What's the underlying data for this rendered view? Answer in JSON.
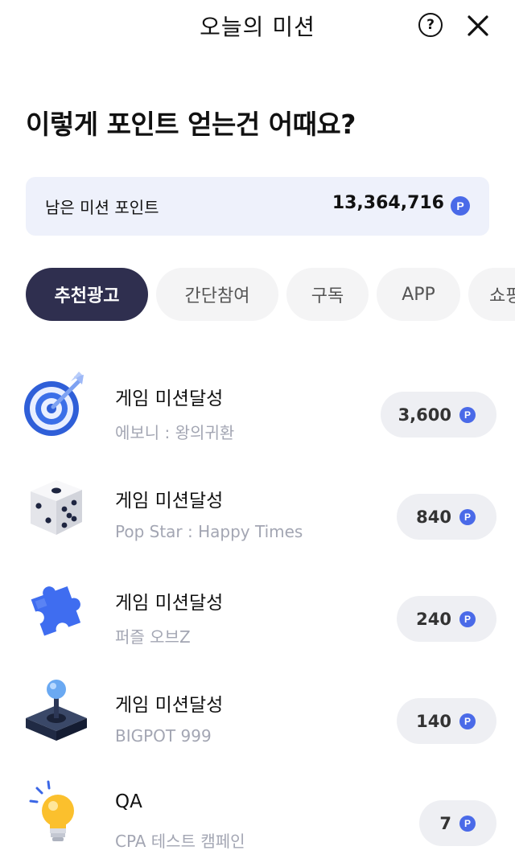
{
  "header": {
    "title": "오늘의 미션",
    "help_icon": "?"
  },
  "headline": "이렇게 포인트 얻는건 어때요?",
  "points": {
    "label": "남은 미션 포인트",
    "value": "13,364,716",
    "unit": "P"
  },
  "tabs": [
    {
      "label": "추천광고",
      "active": true
    },
    {
      "label": "간단참여",
      "active": false
    },
    {
      "label": "구독",
      "active": false
    },
    {
      "label": "APP",
      "active": false
    },
    {
      "label": "쇼핑",
      "active": false
    }
  ],
  "missions": [
    {
      "icon": "target-icon",
      "title": "게임 미션달성",
      "subtitle": "에보니 : 왕의귀환",
      "reward": "3,600",
      "unit": "P"
    },
    {
      "icon": "dice-icon",
      "title": "게임 미션달성",
      "subtitle": "Pop Star : Happy Times",
      "reward": "840",
      "unit": "P"
    },
    {
      "icon": "puzzle-icon",
      "title": "게임 미션달성",
      "subtitle": "퍼즐 오브Z",
      "reward": "240",
      "unit": "P"
    },
    {
      "icon": "joystick-icon",
      "title": "게임 미션달성",
      "subtitle": "BIGPOT 999",
      "reward": "140",
      "unit": "P"
    },
    {
      "icon": "lightbulb-icon",
      "title": "QA",
      "subtitle": "CPA 테스트 캠페인",
      "reward": "7",
      "unit": "P"
    }
  ],
  "colors": {
    "accent": "#4a6ae8",
    "active_tab": "#2f2f4f",
    "points_bg": "#eef1fb"
  }
}
